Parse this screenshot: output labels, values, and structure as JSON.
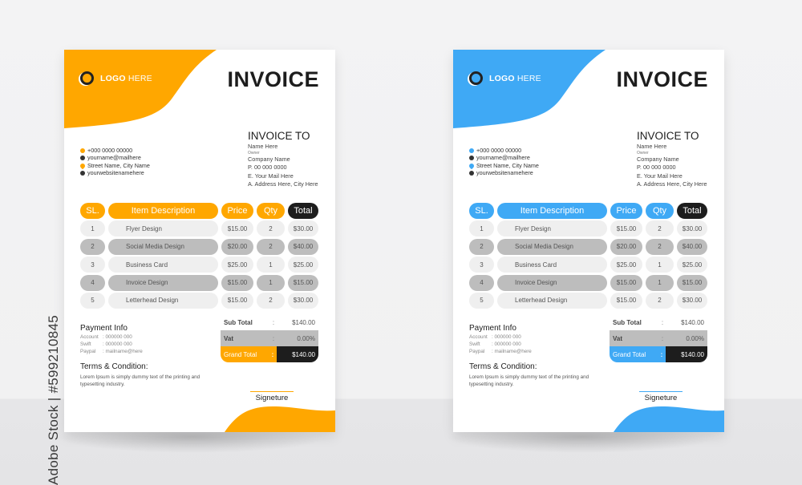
{
  "watermark": {
    "text": "Adobe Stock | #599210845"
  },
  "invoice": {
    "logo_bold": "LOGO",
    "logo_light": " HERE",
    "title": "INVOICE",
    "to_heading": "INVOICE TO",
    "to_name": "Name Here",
    "to_role": "Owner",
    "to_company": "Company Name",
    "to_phone": "P. 00 000 0000",
    "to_email": "E. Your Mail Here",
    "to_address": "A. Address Here, City Here",
    "contacts": [
      {
        "icon": "phone-icon",
        "text": "+000 0000 00000"
      },
      {
        "icon": "mail-icon",
        "text": "yourname@mailhere"
      },
      {
        "icon": "location-pin-icon",
        "text": "Street Name, City Name"
      },
      {
        "icon": "globe-icon",
        "text": "yourwebsitenamehere"
      }
    ],
    "table_headers": [
      "SL.",
      "Item Description",
      "Price",
      "Qty",
      "Total"
    ],
    "rows": [
      {
        "sl": "1",
        "desc": "Flyer Design",
        "price": "$15.00",
        "qty": "2",
        "total": "$30.00"
      },
      {
        "sl": "2",
        "desc": "Social Media Design",
        "price": "$20.00",
        "qty": "2",
        "total": "$40.00"
      },
      {
        "sl": "3",
        "desc": "Business Card",
        "price": "$25.00",
        "qty": "1",
        "total": "$25.00"
      },
      {
        "sl": "4",
        "desc": "Invoice Design",
        "price": "$15.00",
        "qty": "1",
        "total": "$15.00"
      },
      {
        "sl": "5",
        "desc": "Letterhead Design",
        "price": "$15.00",
        "qty": "2",
        "total": "$30.00"
      }
    ],
    "subtotal_label": "Sub Total",
    "subtotal_value": "$140.00",
    "vat_label": "Vat",
    "vat_value": "0.00%",
    "grand_label": "Grand Total",
    "grand_value": "$140.00",
    "colon": ":",
    "payment_heading": "Payment Info",
    "payment": [
      {
        "k": "Account",
        "v": ": 000000 000"
      },
      {
        "k": "Swift",
        "v": ": 000000 000"
      },
      {
        "k": "Paypal",
        "v": ": mailname@here"
      }
    ],
    "terms_heading": "Terms & Condition:",
    "terms_text": "Lorem Ipsum is simply dummy text of the printing and typesetting industry.",
    "signature": "Signeture"
  },
  "variants": [
    {
      "name": "orange",
      "accent": "#FFA700"
    },
    {
      "name": "blue",
      "accent": "#3FA9F5"
    }
  ]
}
